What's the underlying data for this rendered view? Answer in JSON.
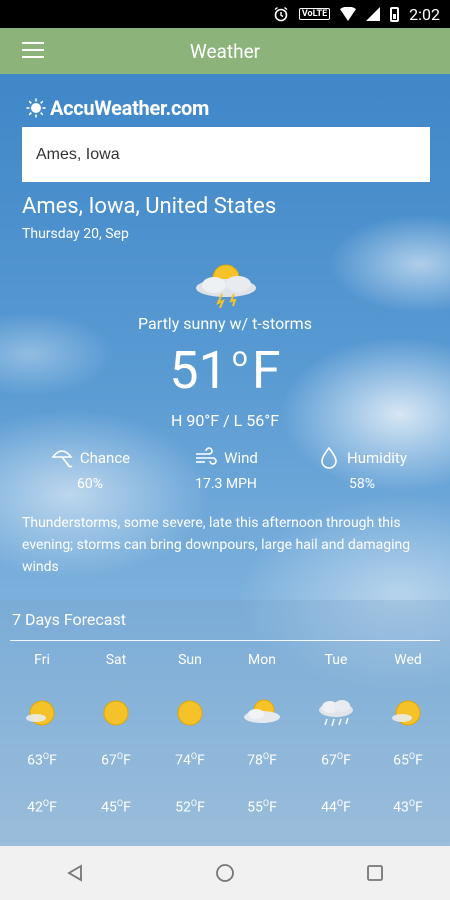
{
  "status_bar": {
    "time": "2:02",
    "network_label": "VoLTE"
  },
  "app_bar": {
    "title": "Weather"
  },
  "brand": {
    "name": "AccuWeather.com"
  },
  "search": {
    "value": "Ames, Iowa"
  },
  "location": "Ames, Iowa, United States",
  "date": "Thursday  20, Sep",
  "current": {
    "condition": "Partly sunny w/ t-storms",
    "temp_value": "51",
    "temp_unit": "F",
    "hilo": "H 90°F / L 56°F"
  },
  "stats": {
    "chance": {
      "label": "Chance",
      "value": "60%"
    },
    "wind": {
      "label": "Wind",
      "value": "17.3 MPH"
    },
    "humidity": {
      "label": "Humidity",
      "value": "58%"
    }
  },
  "summary": "Thunderstorms, some severe, late this afternoon through this evening; storms can bring downpours, large hail and damaging winds",
  "forecast": {
    "title": "7 Days Forecast",
    "days": [
      {
        "day": "Fri",
        "icon": "partly-sunny-icon",
        "hi": "63",
        "lo": "42"
      },
      {
        "day": "Sat",
        "icon": "sunny-icon",
        "hi": "67",
        "lo": "45"
      },
      {
        "day": "Sun",
        "icon": "sunny-icon",
        "hi": "74",
        "lo": "52"
      },
      {
        "day": "Mon",
        "icon": "cloudy-sun-icon",
        "hi": "78",
        "lo": "55"
      },
      {
        "day": "Tue",
        "icon": "rain-cloud-icon",
        "hi": "67",
        "lo": "44"
      },
      {
        "day": "Wed",
        "icon": "partly-sunny-icon",
        "hi": "65",
        "lo": "43"
      }
    ],
    "temp_unit": "F"
  },
  "colors": {
    "app_bar": "#8cb47a",
    "sky_top": "#3f87c8",
    "sun": "#f5c22a"
  }
}
